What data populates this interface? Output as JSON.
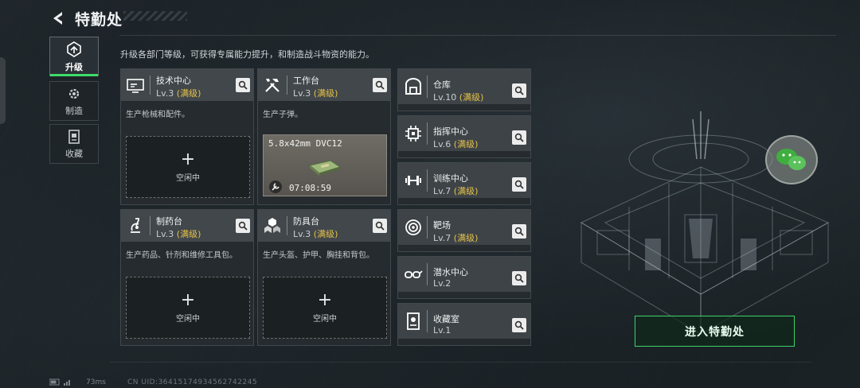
{
  "header": {
    "title": "特勤处",
    "description": "升级各部门等级，可获得专属能力提升，和制造战斗物资的能力。"
  },
  "sidebar": {
    "items": [
      {
        "label": "升级",
        "icon": "upgrade-icon",
        "active": true
      },
      {
        "label": "制造",
        "icon": "gear-icon",
        "active": false
      },
      {
        "label": "收藏",
        "icon": "collection-icon",
        "active": false
      }
    ]
  },
  "facilities": [
    {
      "name": "技术中心",
      "level": "Lv.3",
      "status": "(满级)",
      "desc": "生产枪械和配件。",
      "slot": "空闲中",
      "icon": "tech-center-icon"
    },
    {
      "name": "工作台",
      "level": "Lv.3",
      "status": "(满级)",
      "desc": "生产子弹。",
      "producing": {
        "item": "5.8x42mm DVC12",
        "time": "07:08:59"
      },
      "icon": "workbench-icon"
    },
    {
      "name": "制药台",
      "level": "Lv.3",
      "status": "(满级)",
      "desc": "生产药品、针剂和维修工具包。",
      "slot": "空闲中",
      "icon": "pharmacy-icon"
    },
    {
      "name": "防具台",
      "level": "Lv.3",
      "status": "(满级)",
      "desc": "生产头盔、护甲、胸挂和背包。",
      "slot": "空闲中",
      "icon": "armor-bench-icon"
    }
  ],
  "rows": [
    {
      "name": "仓库",
      "level": "Lv.10",
      "status": "(满级)",
      "icon": "warehouse-icon"
    },
    {
      "name": "指挥中心",
      "level": "Lv.6",
      "status": "(满级)",
      "icon": "command-center-icon"
    },
    {
      "name": "训练中心",
      "level": "Lv.7",
      "status": "(满级)",
      "icon": "dumbbell-icon"
    },
    {
      "name": "靶场",
      "level": "Lv.7",
      "status": "(满级)",
      "icon": "target-icon"
    },
    {
      "name": "潜水中心",
      "level": "Lv.2",
      "status": "",
      "icon": "diving-goggles-icon"
    },
    {
      "name": "收藏室",
      "level": "Lv.1",
      "status": "",
      "icon": "collection-room-icon"
    }
  ],
  "enter_button": "进入特勤处",
  "footer": {
    "ping": "73ms",
    "uid": "CN UID:3641517493456274224​5"
  },
  "colors": {
    "accent": "#3ddc6a",
    "max_level": "#e6c24a"
  }
}
